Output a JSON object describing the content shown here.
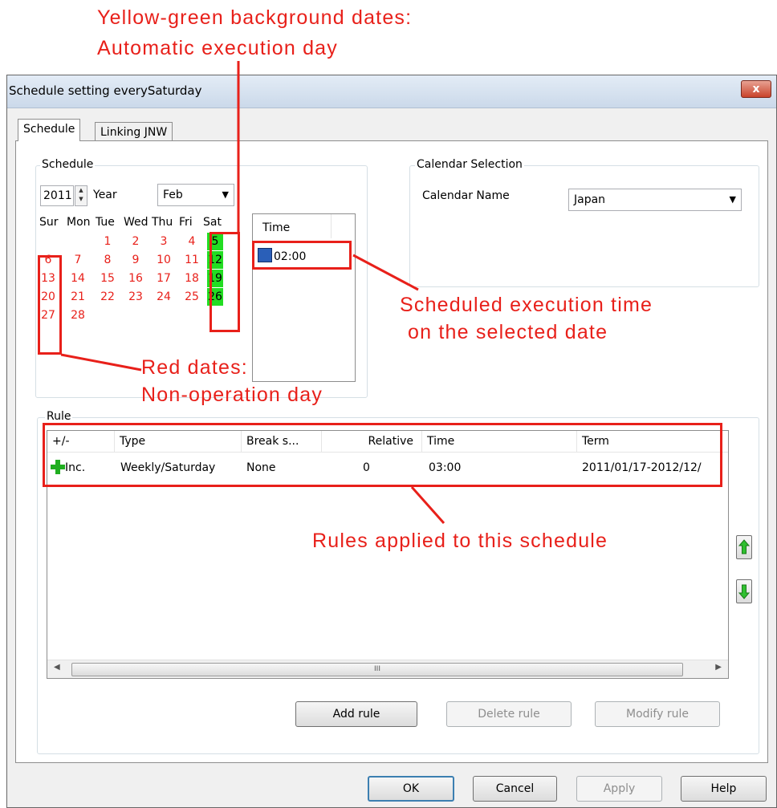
{
  "callouts": {
    "auto_line1": "Yellow-green background dates:",
    "auto_line2": "Automatic execution day",
    "time_line1": "Scheduled execution time",
    "time_line2": "on the selected date",
    "red_line1": "Red dates:",
    "red_line2": "Non-operation day",
    "rules": "Rules applied to this schedule"
  },
  "window": {
    "title": "Schedule setting everySaturday",
    "close_label": "x"
  },
  "tabs": [
    {
      "label": "Schedule"
    },
    {
      "label": "Linking JNW"
    }
  ],
  "schedule_group": {
    "label": "Schedule",
    "year": "2011",
    "year_label": "Year",
    "month": "Feb",
    "weekdays": [
      "Sur",
      "Mon",
      "Tue",
      "Wed",
      "Thu",
      "Fri",
      "Sat"
    ],
    "days": [
      [
        "",
        "",
        "1",
        "2",
        "3",
        "4",
        "5"
      ],
      [
        "6",
        "7",
        "8",
        "9",
        "10",
        "11",
        "12"
      ],
      [
        "13",
        "14",
        "15",
        "16",
        "17",
        "18",
        "19"
      ],
      [
        "20",
        "21",
        "22",
        "23",
        "24",
        "25",
        "26"
      ],
      [
        "27",
        "28",
        "",
        "",
        "",
        "",
        ""
      ]
    ],
    "automatic_days": [
      "5",
      "12",
      "19",
      "26"
    ],
    "time_header": "Time",
    "time_entries": [
      "02:00"
    ]
  },
  "calendar_group": {
    "label": "Calendar Selection",
    "name_label": "Calendar Name",
    "selected": "Japan"
  },
  "rule_group": {
    "label": "Rule",
    "columns": [
      "+/-",
      "Type",
      "Break s...",
      "Relative",
      "Time",
      "Term"
    ],
    "rows": [
      [
        "Inc.",
        "Weekly/Saturday",
        "None",
        "0",
        "03:00",
        "2011/01/17-2012/12/"
      ]
    ],
    "scroll_thumb_label": "III"
  },
  "rule_buttons": {
    "add": "Add rule",
    "delete": "Delete rule",
    "modify": "Modify rule"
  },
  "dialog_buttons": {
    "ok": "OK",
    "cancel": "Cancel",
    "apply": "Apply",
    "help": "Help"
  },
  "colors": {
    "accent_red": "#e8201a",
    "automatic_day": "#22dd22",
    "add_icon": "#1fae1f"
  }
}
